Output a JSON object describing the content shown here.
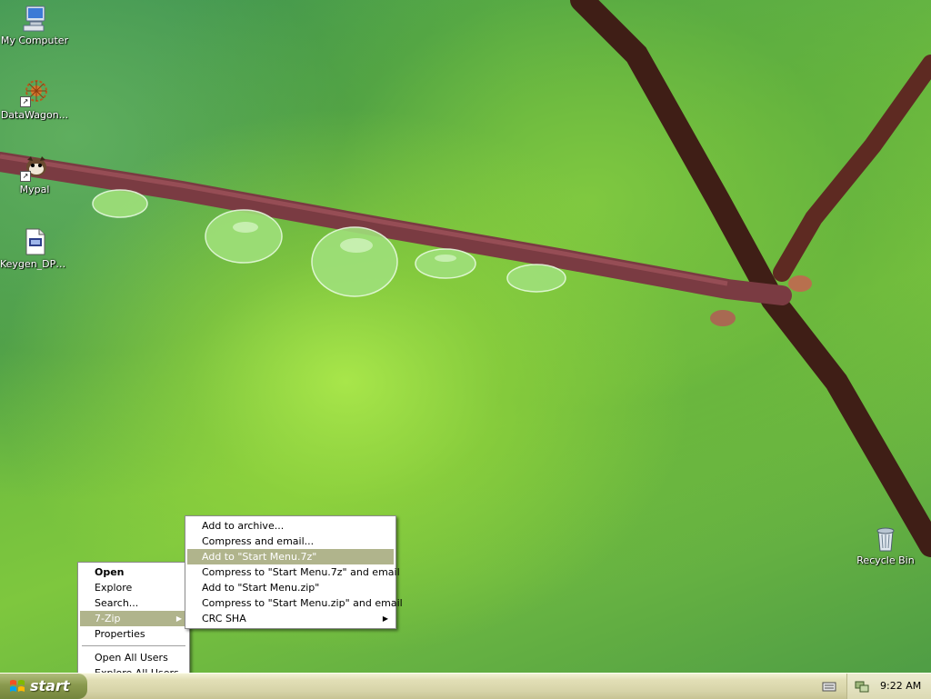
{
  "desktop": {
    "icons": [
      {
        "label": "My Computer",
        "icon": "computer-icon"
      },
      {
        "label": "DataWagon...",
        "icon": "datawagon-icon"
      },
      {
        "label": "Mypal",
        "icon": "mypal-icon"
      },
      {
        "label": "Keygen_DPF...",
        "icon": "document-icon"
      },
      {
        "label": "Recycle Bin",
        "icon": "recycle-bin-icon"
      }
    ]
  },
  "context_menu": {
    "items": [
      {
        "label": "Open",
        "default": true
      },
      {
        "label": "Explore"
      },
      {
        "label": "Search..."
      },
      {
        "label": "7-Zip",
        "submenu": true,
        "highlighted": true
      },
      {
        "label": "Properties"
      },
      {
        "label": "Open All Users"
      },
      {
        "label": "Explore All Users"
      }
    ]
  },
  "zip_submenu": {
    "items": [
      {
        "label": "Add to archive..."
      },
      {
        "label": "Compress and email..."
      },
      {
        "label": "Add to \"Start Menu.7z\"",
        "highlighted": true
      },
      {
        "label": "Compress to \"Start Menu.7z\" and email"
      },
      {
        "label": "Add to \"Start Menu.zip\""
      },
      {
        "label": "Compress to \"Start Menu.zip\" and email"
      },
      {
        "label": "CRC SHA",
        "submenu": true
      }
    ]
  },
  "taskbar": {
    "start_label": "start",
    "clock": "9:22 AM",
    "tray_icons": [
      "keyboard-icon",
      "network-icon"
    ]
  },
  "colors": {
    "menu_highlight": "#b0b48c",
    "taskbar": "#d6d3a8",
    "start_button": "#8a9a4e"
  }
}
